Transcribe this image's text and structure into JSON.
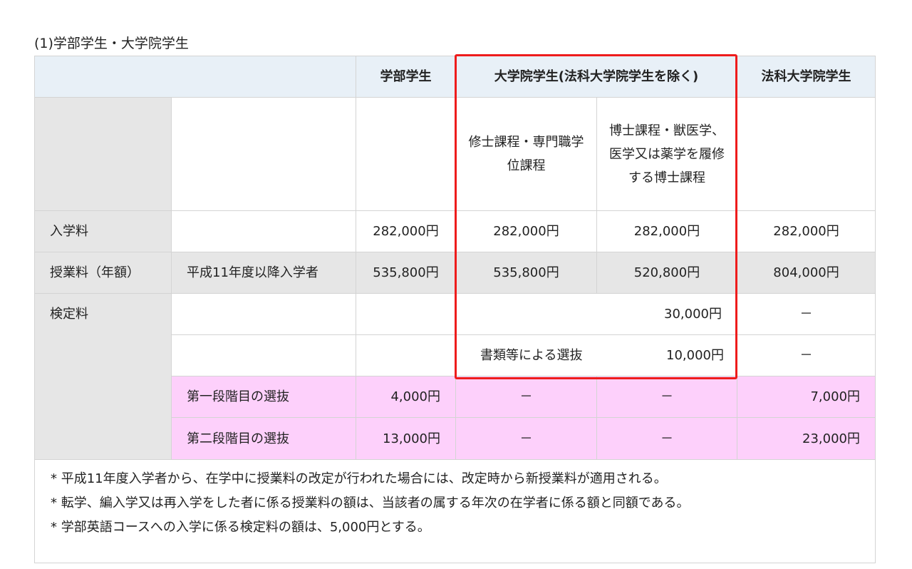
{
  "caption": "(1)学部学生・大学院学生",
  "headers": {
    "undergrad": "学部学生",
    "grad": "大学院学生(法科大学院学生を除く)",
    "law": "法科大学院学生"
  },
  "subheaders": {
    "masters": "修士課程・専門職学位課程",
    "doctoral": "博士課程・獣医学、医学又は薬学を履修する博士課程"
  },
  "rows": {
    "admission": {
      "label": "入学料",
      "undergrad": "282,000円",
      "masters": "282,000円",
      "doctoral": "282,000円",
      "law": "282,000円"
    },
    "tuition": {
      "label": "授業料（年額）",
      "sub": "平成11年度以降入学者",
      "undergrad": "535,800円",
      "masters": "535,800円",
      "doctoral": "520,800円",
      "law": "804,000円"
    },
    "exam": {
      "label": "検定料",
      "general_grad": "30,000円",
      "general_law": "－",
      "doc_label": "書類等による選抜",
      "doc_grad": "10,000円",
      "doc_law": "－",
      "stage1": {
        "label": "第一段階目の選抜",
        "undergrad": "4,000円",
        "masters": "－",
        "doctoral": "－",
        "law": "7,000円"
      },
      "stage2": {
        "label": "第二段階目の選抜",
        "undergrad": "13,000円",
        "masters": "－",
        "doctoral": "－",
        "law": "23,000円"
      }
    }
  },
  "notes": [
    "* 平成11年度入学者から、在学中に授業料の改定が行われた場合には、改定時から新授業料が適用される。",
    "* 転学、編入学又は再入学をした者に係る授業料の額は、当該者の属する年次の在学者に係る額と同額である。",
    "* 学部英語コースへの入学に係る検定料の額は、5,000円とする。"
  ],
  "colors": {
    "header_bg": "#e8f0f7",
    "label_bg": "#e6e6e6",
    "pink_bg": "#fdd0fb",
    "highlight_border": "#ee1c1c"
  }
}
